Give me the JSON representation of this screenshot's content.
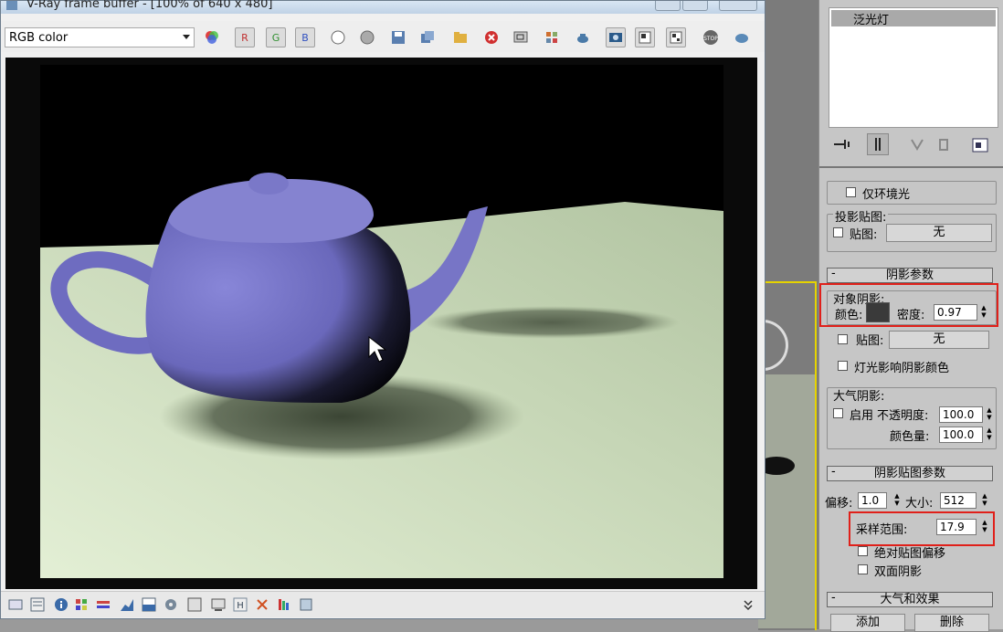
{
  "window": {
    "title": "V-Ray frame buffer - [100% of 640 x 480]"
  },
  "toolbar": {
    "channel_select": "RGB color",
    "buttons": [
      "color-balance",
      "R",
      "G",
      "B",
      "white",
      "gray",
      "save",
      "copy",
      "open",
      "clear",
      "region",
      "track",
      "render-last",
      "compare",
      "history",
      "lut",
      "stop",
      "info"
    ]
  },
  "status_icons": [
    "panel",
    "correction",
    "info",
    "colors",
    "levels",
    "curves",
    "bg",
    "stamp",
    "histogram",
    "lut",
    "H",
    "link",
    "flag",
    "settings"
  ],
  "panel": {
    "light_list": [
      "泛光灯"
    ],
    "ambient_only_label": "仅环境光",
    "proj_map_group": "投影贴图:",
    "proj_map_label": "贴图:",
    "proj_map_button": "无",
    "shadow_params_title": "阴影参数",
    "object_shadows_group": "对象阴影:",
    "color_label": "颜色:",
    "density_label": "密度:",
    "density_value": "0.97",
    "map_label": "贴图:",
    "map_button": "无",
    "light_affects_label": "灯光影响阴影颜色",
    "atmos_group": "大气阴影:",
    "atmos_on_label": "启用",
    "opacity_label": "不透明度:",
    "opacity_value": "100.0",
    "color_amount_label": "颜色量:",
    "color_amount_value": "100.0",
    "shadow_map_title": "阴影贴图参数",
    "bias_label": "偏移:",
    "bias_value": "1.0",
    "size_label": "大小:",
    "size_value": "512",
    "sample_range_label": "采样范围:",
    "sample_range_value": "17.9",
    "abs_bias_label": "绝对贴图偏移",
    "two_sided_label": "双面阴影",
    "atmos_effects_title": "大气和效果",
    "add_button": "添加",
    "delete_button": "删除"
  },
  "colors": {
    "shadow_swatch": "#3a3a3a",
    "highlight": "#e0201a",
    "teapot": "#7a78c8",
    "floor": "#c9d8b8"
  }
}
